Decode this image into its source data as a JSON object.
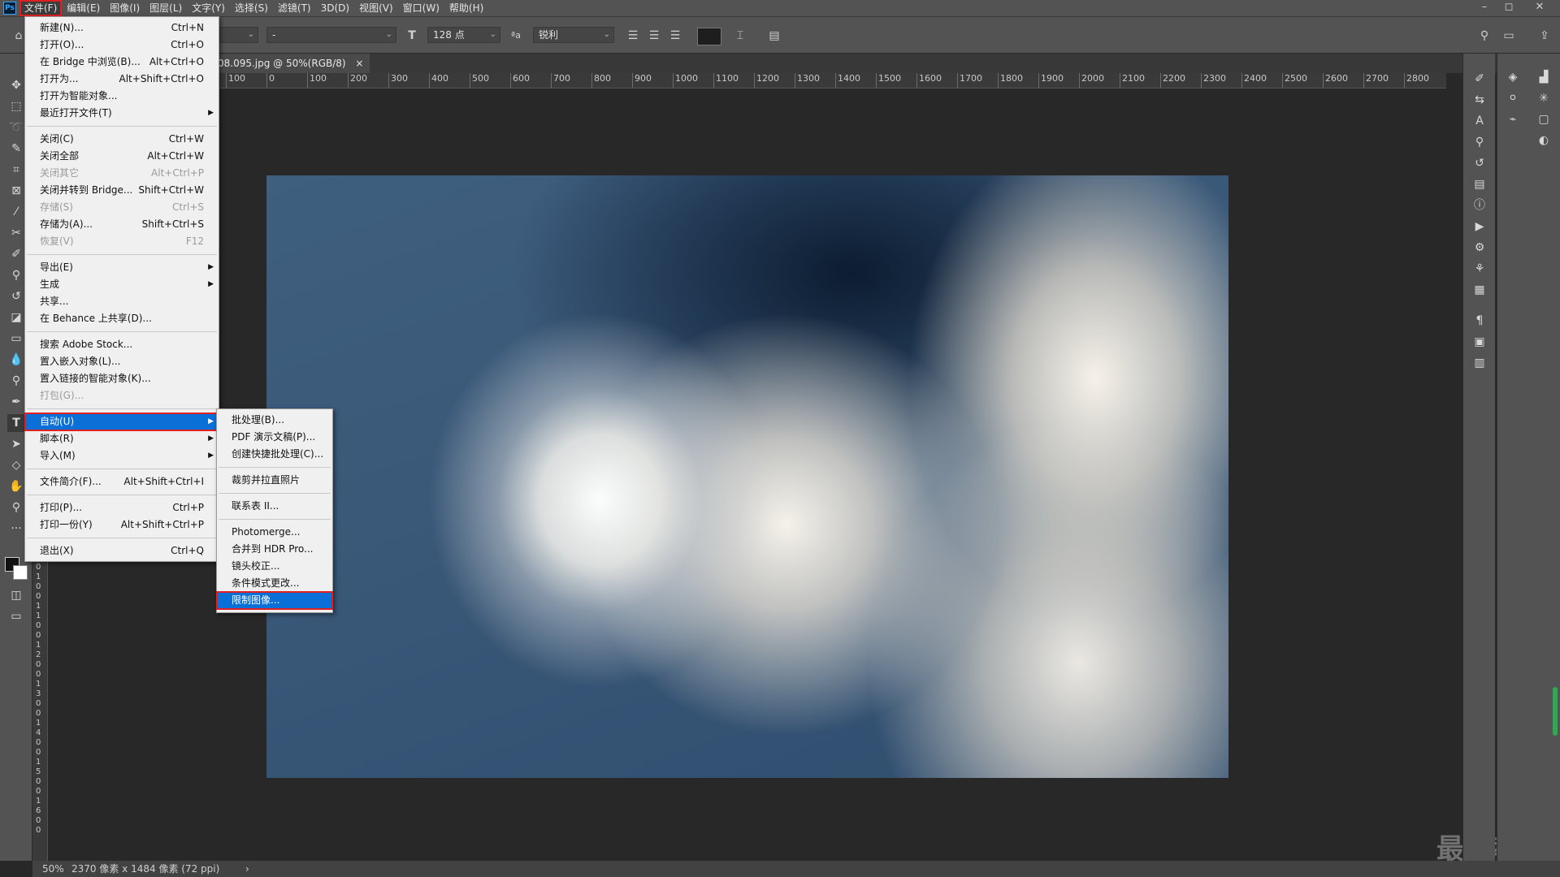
{
  "menubar": {
    "logo": "Ps",
    "items": [
      "文件(F)",
      "编辑(E)",
      "图像(I)",
      "图层(L)",
      "文字(Y)",
      "选择(S)",
      "滤镜(T)",
      "3D(D)",
      "视图(V)",
      "窗口(W)",
      "帮助(H)"
    ],
    "active_index": 0
  },
  "window_controls": [
    "–",
    "◻",
    "✕"
  ],
  "optbar": {
    "font_style": "-",
    "font_size": "128 点",
    "aa_label": "ªa",
    "antialias": "锐利"
  },
  "doc_tab": {
    "title": "08.095.jpg @ 50%(RGB/8)",
    "close": "×"
  },
  "ruler": {
    "h_labels": [
      "100",
      "0",
      "100",
      "200",
      "300",
      "400",
      "500",
      "600",
      "700",
      "800",
      "900",
      "1000",
      "1100",
      "1200",
      "1300",
      "1400",
      "1500",
      "1600",
      "1700",
      "1800",
      "1900",
      "2000",
      "2100",
      "2200",
      "2300",
      "2400",
      "2500",
      "2600",
      "2700",
      "2800"
    ],
    "v_labels": [
      "0",
      "1",
      "0",
      "0",
      "1",
      "1",
      "0",
      "0",
      "1",
      "2",
      "0",
      "0",
      "1",
      "3",
      "0",
      "0",
      "1",
      "4",
      "0",
      "0",
      "1",
      "5",
      "0",
      "0",
      "1",
      "6",
      "0",
      "0"
    ]
  },
  "file_menu": [
    {
      "label": "新建(N)...",
      "shortcut": "Ctrl+N"
    },
    {
      "label": "打开(O)...",
      "shortcut": "Ctrl+O"
    },
    {
      "label": "在 Bridge 中浏览(B)...",
      "shortcut": "Alt+Ctrl+O"
    },
    {
      "label": "打开为...",
      "shortcut": "Alt+Shift+Ctrl+O"
    },
    {
      "label": "打开为智能对象...",
      "shortcut": ""
    },
    {
      "label": "最近打开文件(T)",
      "shortcut": "",
      "submenu": true
    },
    {
      "sep": true
    },
    {
      "label": "关闭(C)",
      "shortcut": "Ctrl+W"
    },
    {
      "label": "关闭全部",
      "shortcut": "Alt+Ctrl+W"
    },
    {
      "label": "关闭其它",
      "shortcut": "Alt+Ctrl+P",
      "disabled": true
    },
    {
      "label": "关闭并转到 Bridge...",
      "shortcut": "Shift+Ctrl+W"
    },
    {
      "label": "存储(S)",
      "shortcut": "Ctrl+S",
      "disabled": true
    },
    {
      "label": "存储为(A)...",
      "shortcut": "Shift+Ctrl+S"
    },
    {
      "label": "恢复(V)",
      "shortcut": "F12",
      "disabled": true
    },
    {
      "sep": true
    },
    {
      "label": "导出(E)",
      "shortcut": "",
      "submenu": true
    },
    {
      "label": "生成",
      "shortcut": "",
      "submenu": true
    },
    {
      "label": "共享...",
      "shortcut": ""
    },
    {
      "label": "在 Behance 上共享(D)...",
      "shortcut": ""
    },
    {
      "sep": true
    },
    {
      "label": "搜索 Adobe Stock...",
      "shortcut": ""
    },
    {
      "label": "置入嵌入对象(L)...",
      "shortcut": ""
    },
    {
      "label": "置入链接的智能对象(K)...",
      "shortcut": ""
    },
    {
      "label": "打包(G)...",
      "shortcut": "",
      "disabled": true
    },
    {
      "sep": true
    },
    {
      "label": "自动(U)",
      "shortcut": "",
      "submenu": true,
      "highlighted": true
    },
    {
      "label": "脚本(R)",
      "shortcut": "",
      "submenu": true
    },
    {
      "label": "导入(M)",
      "shortcut": "",
      "submenu": true
    },
    {
      "sep": true
    },
    {
      "label": "文件简介(F)...",
      "shortcut": "Alt+Shift+Ctrl+I"
    },
    {
      "sep": true
    },
    {
      "label": "打印(P)...",
      "shortcut": "Ctrl+P"
    },
    {
      "label": "打印一份(Y)",
      "shortcut": "Alt+Shift+Ctrl+P"
    },
    {
      "sep": true
    },
    {
      "label": "退出(X)",
      "shortcut": "Ctrl+Q"
    }
  ],
  "auto_submenu": [
    {
      "label": "批处理(B)..."
    },
    {
      "label": "PDF 演示文稿(P)..."
    },
    {
      "label": "创建快捷批处理(C)..."
    },
    {
      "sep": true
    },
    {
      "label": "裁剪并拉直照片"
    },
    {
      "sep": true
    },
    {
      "label": "联系表 II..."
    },
    {
      "sep": true
    },
    {
      "label": "Photomerge..."
    },
    {
      "label": "合并到 HDR Pro..."
    },
    {
      "label": "镜头校正..."
    },
    {
      "label": "条件模式更改..."
    },
    {
      "label": "限制图像...",
      "highlighted": true
    }
  ],
  "status": {
    "zoom": "50%",
    "info": "2370 像素 x 1484 像素 (72 ppi)",
    "arrow": "›"
  },
  "watermark": "最需教育",
  "colors": {
    "ui_bg": "#535353",
    "workspace": "#282828",
    "menu_bg": "#f0f0f0",
    "highlight": "#0a6fd6",
    "annotation_red": "#e02020"
  }
}
